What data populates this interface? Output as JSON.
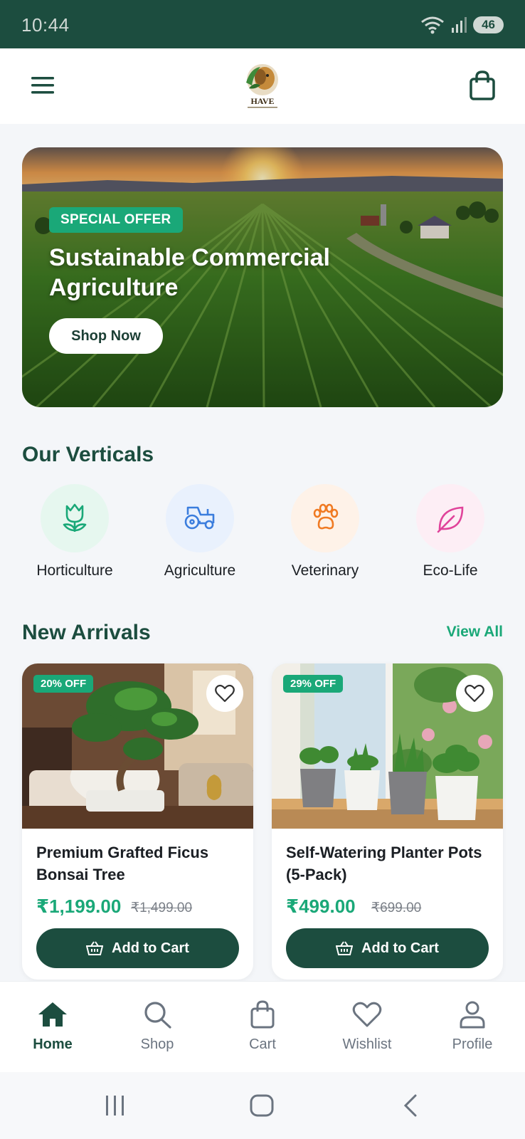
{
  "status_bar": {
    "time": "10:44",
    "battery": "46",
    "wifi_badge": "5"
  },
  "header": {
    "menu_icon": "hamburger-menu-icon",
    "logo_text": "HAVE",
    "bag_icon": "shopping-bag-icon"
  },
  "hero": {
    "badge": "SPECIAL OFFER",
    "title": "Sustainable Commercial Agriculture",
    "button": "Shop Now"
  },
  "verticals": {
    "title": "Our Verticals",
    "items": [
      {
        "label": "Horticulture",
        "icon": "tulip-icon",
        "color": "#1aa878",
        "bg": "#e6f7ef"
      },
      {
        "label": "Agriculture",
        "icon": "tractor-icon",
        "color": "#3b7ddd",
        "bg": "#e9f1fd"
      },
      {
        "label": "Veterinary",
        "icon": "paw-icon",
        "color": "#f07a22",
        "bg": "#fef2e8"
      },
      {
        "label": "Eco-Life",
        "icon": "leaf-icon",
        "color": "#e0439a",
        "bg": "#fdeef5"
      }
    ]
  },
  "new_arrivals": {
    "title": "New Arrivals",
    "view_all": "View All",
    "products": [
      {
        "discount": "20% OFF",
        "name": "Premium Grafted Ficus Bonsai Tree",
        "price": "₹1,199.00",
        "old_price": "₹1,499.00",
        "button": "Add to Cart"
      },
      {
        "discount": "29% OFF",
        "name": "Self-Watering Planter Pots (5-Pack)",
        "price": "₹499.00",
        "old_price": "₹699.00",
        "button": "Add to Cart"
      }
    ]
  },
  "bottom_nav": {
    "items": [
      {
        "label": "Home",
        "icon": "home-icon",
        "active": true
      },
      {
        "label": "Shop",
        "icon": "search-icon",
        "active": false
      },
      {
        "label": "Cart",
        "icon": "cart-bag-icon",
        "active": false
      },
      {
        "label": "Wishlist",
        "icon": "heart-icon",
        "active": false
      },
      {
        "label": "Profile",
        "icon": "user-icon",
        "active": false
      }
    ]
  },
  "colors": {
    "brand_dark": "#1c4d3f",
    "accent": "#1aa878"
  }
}
